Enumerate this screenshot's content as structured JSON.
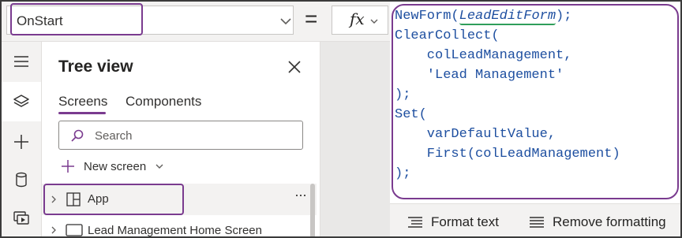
{
  "formula_bar": {
    "property_value": "OnStart",
    "equals": "=",
    "fx_label": "fx"
  },
  "rail": {
    "icons": [
      "hamburger-icon",
      "layers-icon",
      "plus-icon",
      "database-icon",
      "media-icon"
    ]
  },
  "tree_view": {
    "title": "Tree view",
    "tabs": [
      {
        "label": "Screens",
        "active": true
      },
      {
        "label": "Components",
        "active": false
      }
    ],
    "search_placeholder": "Search",
    "new_screen_label": "New screen",
    "items": [
      {
        "label": "App",
        "selected": true
      },
      {
        "label": "Lead Management Home Screen",
        "selected": false
      }
    ],
    "more_label": "···"
  },
  "code": {
    "line1_pre": "NewForm(",
    "line1_arg": "LeadEditForm",
    "line1_post": ");",
    "line2": "ClearCollect(",
    "line3": "    colLeadManagement,",
    "line4": "    'Lead Management'",
    "line5": ");",
    "line6": "Set(",
    "line7": "    varDefaultValue,",
    "line8": "    First(colLeadManagement)",
    "line9": ");"
  },
  "editor_footer": {
    "format_text": "Format text",
    "remove_formatting": "Remove formatting"
  },
  "colors": {
    "accent": "#7a3b8f",
    "code_blue": "#1e4fa0",
    "highlight_green": "#2f9e5a",
    "panel_bg": "#f3f2f1"
  }
}
